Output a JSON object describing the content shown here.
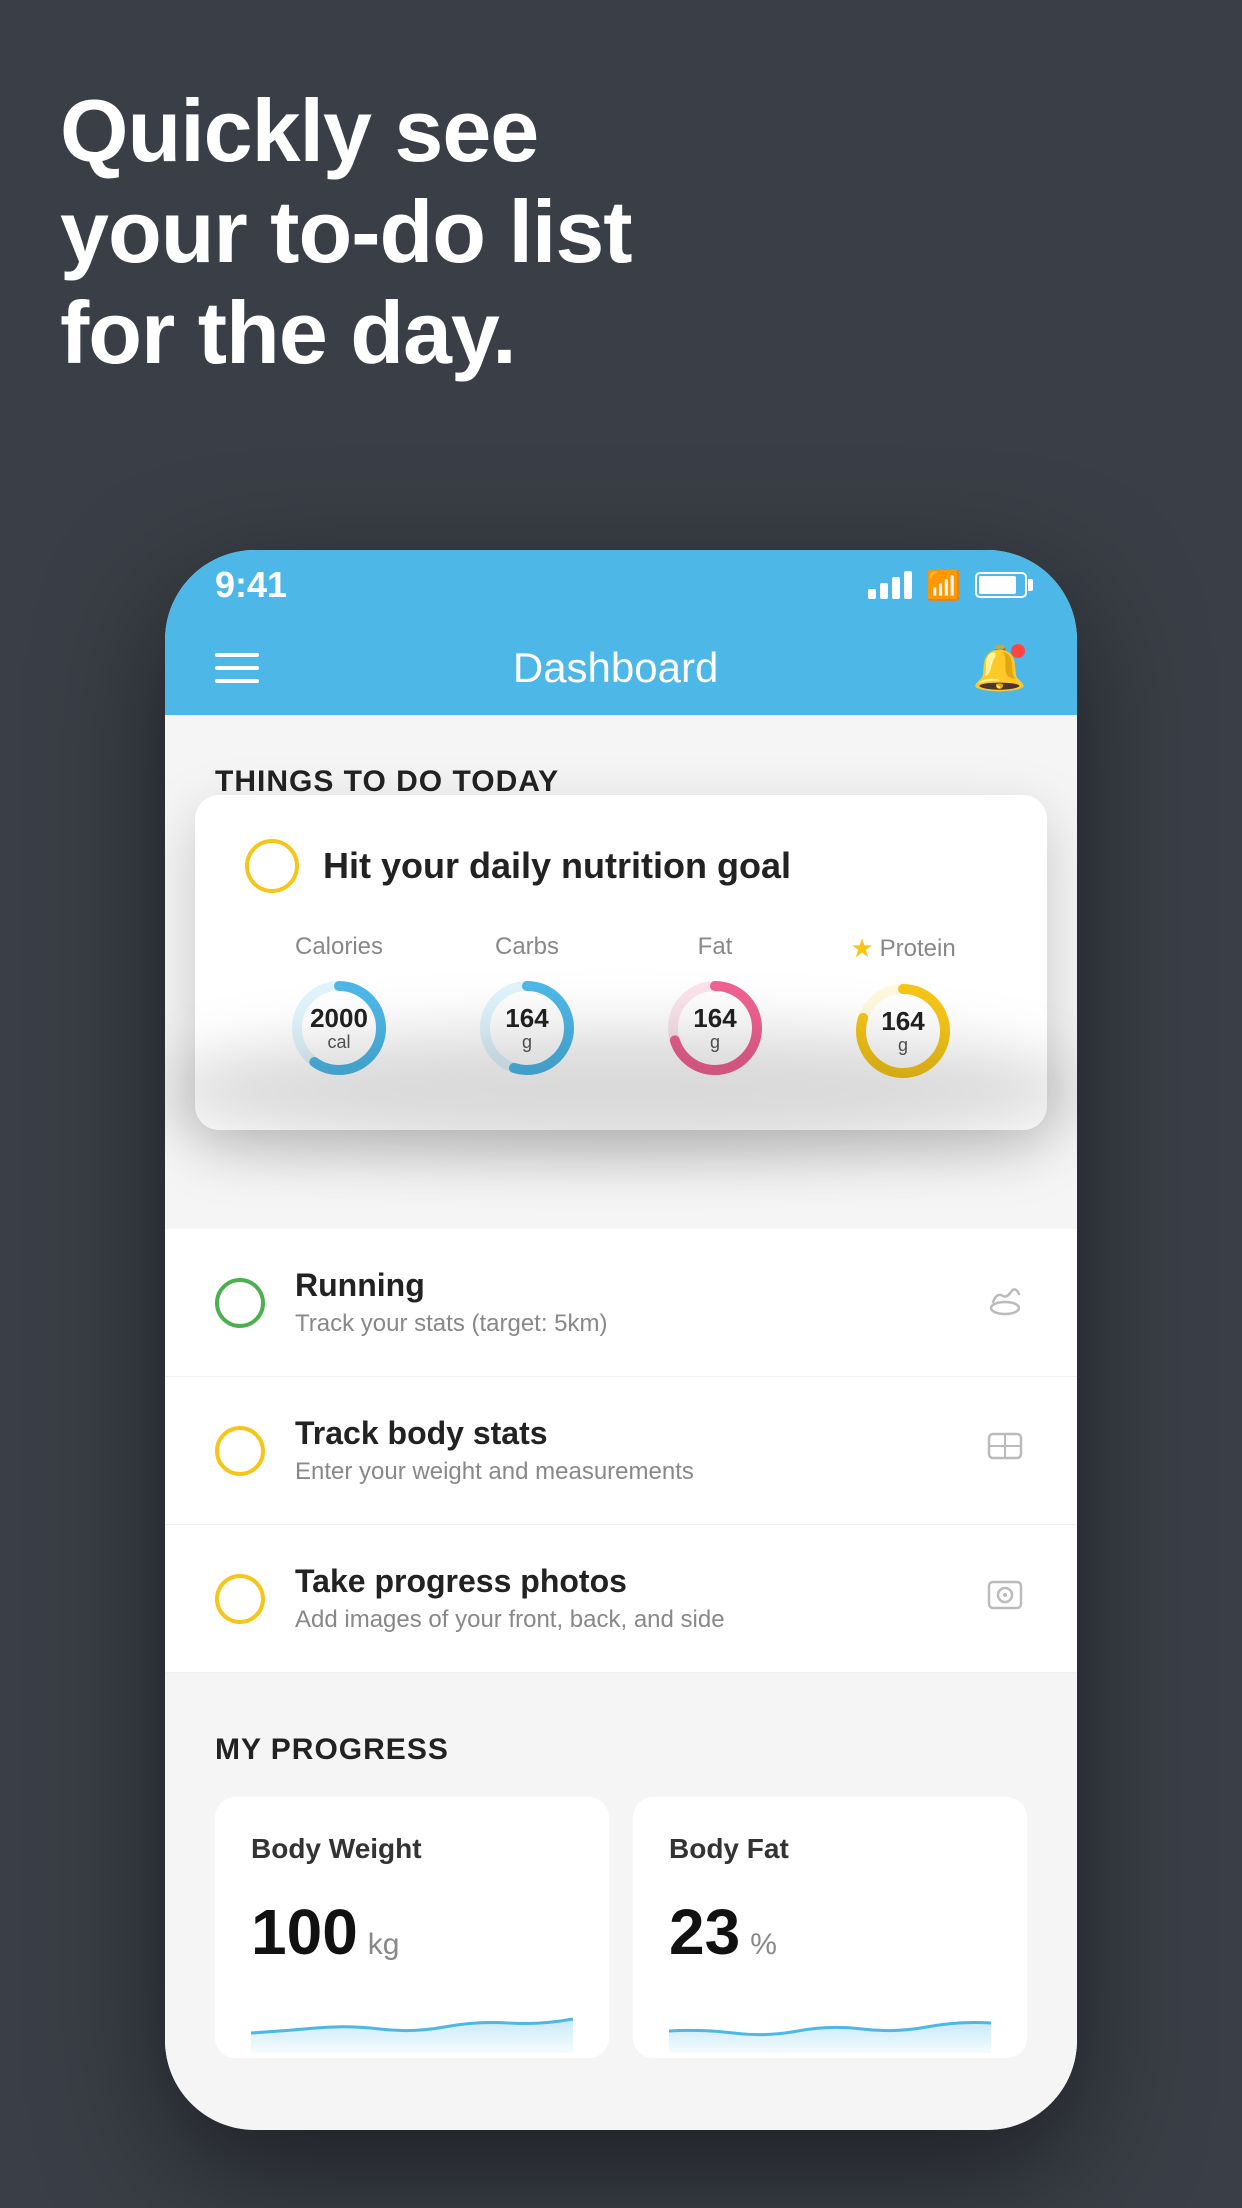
{
  "headline": {
    "line1": "Quickly see",
    "line2": "your to-do list",
    "line3": "for the day."
  },
  "status_bar": {
    "time": "9:41",
    "signal": "signal",
    "wifi": "wifi",
    "battery": "battery"
  },
  "nav": {
    "title": "Dashboard"
  },
  "things_title": "THINGS TO DO TODAY",
  "featured_card": {
    "title": "Hit your daily nutrition goal",
    "nutrition": [
      {
        "label": "Calories",
        "value": "2000",
        "unit": "cal",
        "color": "#4db8e8",
        "track_color": "#e0f4fc",
        "percent": 60
      },
      {
        "label": "Carbs",
        "value": "164",
        "unit": "g",
        "color": "#4db8e8",
        "track_color": "#e0f4fc",
        "percent": 55
      },
      {
        "label": "Fat",
        "value": "164",
        "unit": "g",
        "color": "#f06292",
        "track_color": "#fce4ec",
        "percent": 70
      },
      {
        "label": "Protein",
        "value": "164",
        "unit": "g",
        "color": "#f5c518",
        "track_color": "#fff9e0",
        "starred": true,
        "percent": 80
      }
    ]
  },
  "todo_items": [
    {
      "id": "running",
      "title": "Running",
      "subtitle": "Track your stats (target: 5km)",
      "circle_color": "green",
      "icon": "👟"
    },
    {
      "id": "track-body",
      "title": "Track body stats",
      "subtitle": "Enter your weight and measurements",
      "circle_color": "yellow",
      "icon": "⚖"
    },
    {
      "id": "progress-photos",
      "title": "Take progress photos",
      "subtitle": "Add images of your front, back, and side",
      "circle_color": "yellow",
      "icon": "🪞"
    }
  ],
  "progress_title": "MY PROGRESS",
  "progress_cards": [
    {
      "title": "Body Weight",
      "value": "100",
      "unit": "kg"
    },
    {
      "title": "Body Fat",
      "value": "23",
      "unit": "%"
    }
  ]
}
